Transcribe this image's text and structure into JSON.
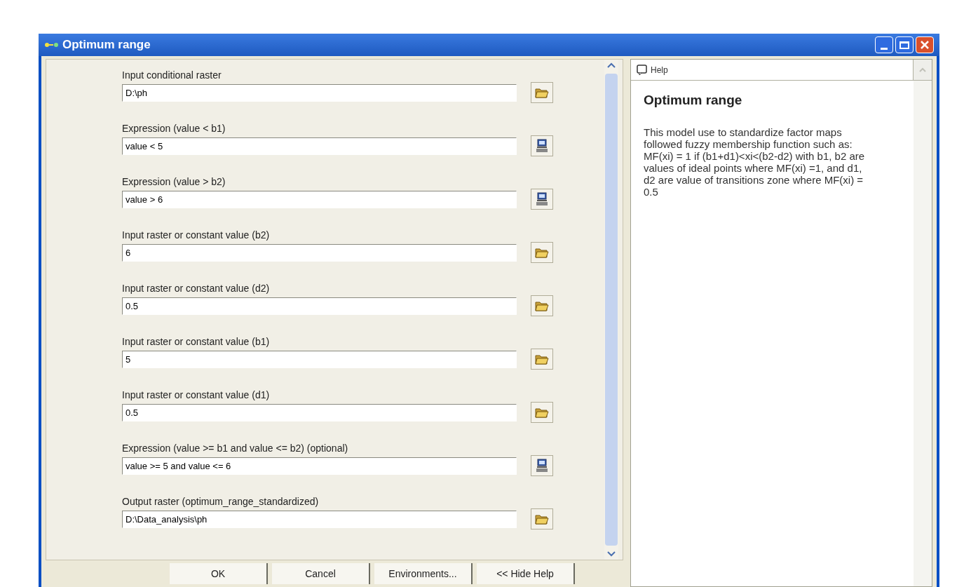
{
  "window": {
    "title": "Optimum range"
  },
  "parameters": [
    {
      "label": "Input conditional raster",
      "value": "D:\\ph",
      "kind": "browse"
    },
    {
      "label": "Expression (value < b1)",
      "value": "value < 5",
      "kind": "sql"
    },
    {
      "label": "Expression (value > b2)",
      "value": "value > 6",
      "kind": "sql"
    },
    {
      "label": "Input raster or constant value (b2)",
      "value": "6",
      "kind": "browse"
    },
    {
      "label": "Input raster or constant value (d2)",
      "value": "0.5",
      "kind": "browse"
    },
    {
      "label": "Input raster or constant value (b1)",
      "value": "5",
      "kind": "browse"
    },
    {
      "label": "Input raster or constant value (d1)",
      "value": "0.5",
      "kind": "browse"
    },
    {
      "label": "Expression (value >= b1 and value <= b2) (optional)",
      "value": "value >= 5 and value <= 6",
      "kind": "sql"
    },
    {
      "label": "Output raster (optimum_range_standardized)",
      "value": "D:\\Data_analysis\\ph",
      "kind": "browse"
    }
  ],
  "buttons": [
    "OK",
    "Cancel",
    "Environments...",
    "<< Hide Help"
  ],
  "help": {
    "tab": "Help",
    "title": "Optimum range",
    "text": "This model use to standardize factor maps followed fuzzy membership function such as: MF(xi) = 1 if (b1+d1)<xi<(b2-d2) with b1, b2 are values of ideal points where MF(xi) =1, and d1, d2 are value of transitions zone where MF(xi) = 0.5"
  }
}
